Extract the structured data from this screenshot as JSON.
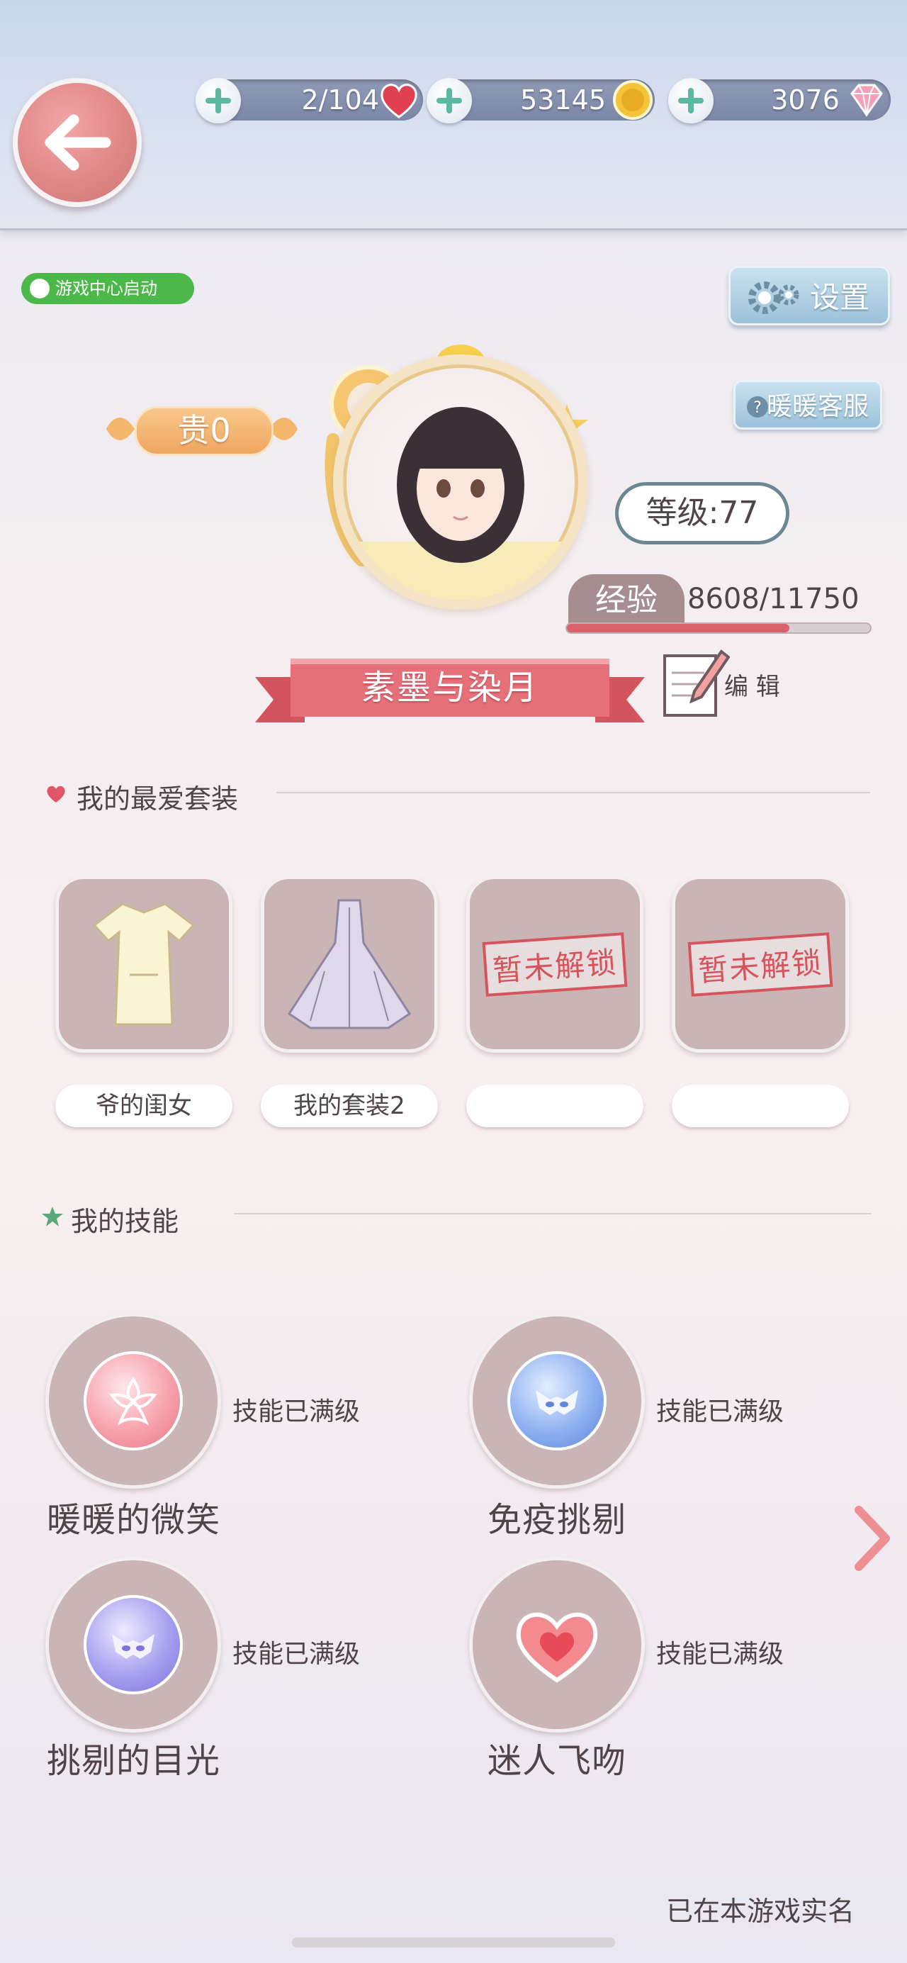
{
  "header": {
    "stamina": "2/104",
    "gold": "53145",
    "diamonds": "3076"
  },
  "game_center_badge": "游戏中心启动",
  "settings_label": "设置",
  "customer_service_label": "暖暖客服",
  "profile": {
    "noble": "贵0",
    "level": "等级:77",
    "exp_label": "经验",
    "exp_value": "8608/11750",
    "exp_fraction": 0.7326,
    "name": "素墨与染月",
    "edit_label": "编 辑"
  },
  "favorites": {
    "title": "我的最爱套装",
    "items": [
      {
        "label": "爷的闺女",
        "locked": false
      },
      {
        "label": "我的套装2",
        "locked": false
      },
      {
        "label": "",
        "locked": true,
        "lock_text": "暂未解锁"
      },
      {
        "label": "",
        "locked": true,
        "lock_text": "暂未解锁"
      }
    ]
  },
  "skills": {
    "title": "我的技能",
    "items": [
      {
        "name": "暖暖的微笑",
        "status": "技能已满级",
        "icon": "sakura-icon"
      },
      {
        "name": "免疫挑剔",
        "status": "技能已满级",
        "icon": "winged-mask-icon"
      },
      {
        "name": "挑剔的目光",
        "status": "技能已满级",
        "icon": "mask-icon"
      },
      {
        "name": "迷人飞吻",
        "status": "技能已满级",
        "icon": "heart-icon"
      }
    ]
  },
  "footer": "已在本游戏实名",
  "colors": {
    "accent_pink": "#e06c78",
    "button_blue": "#9cc2d9",
    "tile": "#c9b4b6"
  }
}
